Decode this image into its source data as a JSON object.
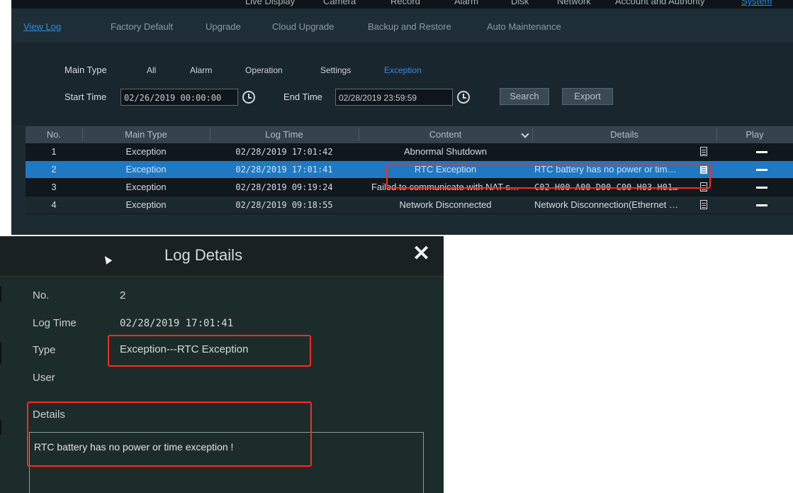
{
  "top_nav": {
    "items": [
      "Live Display",
      "Camera",
      "Record",
      "Alarm",
      "Disk",
      "Network",
      "Account and Authority",
      "System"
    ],
    "active": "System"
  },
  "sub_tabs": [
    "View Log",
    "Factory Default",
    "Upgrade",
    "Cloud Upgrade",
    "Backup and Restore",
    "Auto Maintenance"
  ],
  "filter": {
    "main_type_label": "Main Type",
    "types": [
      "All",
      "Alarm",
      "Operation",
      "Settings",
      "Exception"
    ],
    "active_type": "Exception",
    "start_label": "Start Time",
    "start_value": "02/26/2019 00:00:00",
    "end_label": "End Time",
    "end_value": "02/28/2019 23:59:59",
    "search_label": "Search",
    "export_label": "Export"
  },
  "table": {
    "headers": [
      "No.",
      "Main Type",
      "Log Time",
      "Content",
      "Details",
      "Play"
    ],
    "rows": [
      {
        "no": "1",
        "type": "Exception",
        "time": "02/28/2019 17:01:42",
        "content": "Abnormal Shutdown",
        "details": ""
      },
      {
        "no": "2",
        "type": "Exception",
        "time": "02/28/2019 17:01:41",
        "content": "RTC Exception",
        "details": "RTC battery has no power or tim…"
      },
      {
        "no": "3",
        "type": "Exception",
        "time": "02/28/2019 09:19:24",
        "content": "Failed to communicate with NAT s…",
        "details": "C02-H00-A00-D00-C00-H03-H01…"
      },
      {
        "no": "4",
        "type": "Exception",
        "time": "02/28/2019 09:18:55",
        "content": "Network Disconnected",
        "details": "Network Disconnection(Ethernet …"
      }
    ],
    "selected_row": 2
  },
  "dialog": {
    "title": "Log Details",
    "close": "✕",
    "no_label": "No.",
    "no_value": "2",
    "time_label": "Log Time",
    "time_value": "02/28/2019 17:01:41",
    "type_label": "Type",
    "type_value": "Exception---RTC Exception",
    "user_label": "User",
    "user_value": "",
    "details_label": "Details",
    "details_value": "RTC battery has no power or time exception !"
  },
  "colors": {
    "accent": "#2f8ee0",
    "selected_row": "#1f79c2",
    "highlight": "#ff2a1f",
    "panel_bg": "#1c2a32",
    "dialog_bg": "#1c2c2b"
  }
}
